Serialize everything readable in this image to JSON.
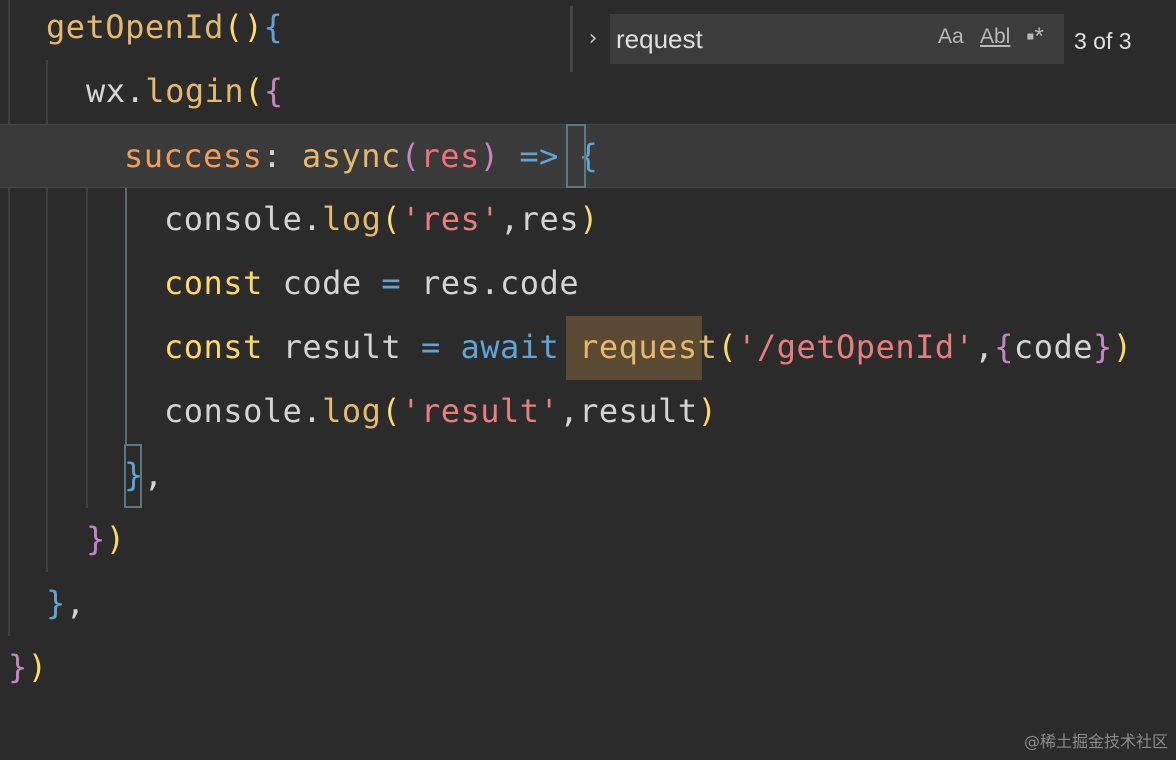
{
  "editor": {
    "lines": {
      "l1": [
        "getOpenId",
        "()",
        "{"
      ],
      "l2": [
        "wx",
        ".",
        "login",
        "(",
        "{"
      ],
      "l3": [
        "success",
        ": ",
        "async",
        "(",
        "res",
        ") ",
        "=>",
        " ",
        "{"
      ],
      "l4": [
        "console",
        ".",
        "log",
        "(",
        "'res'",
        ",",
        "res",
        ")"
      ],
      "l5": [
        "const",
        " code ",
        "=",
        " res",
        ".",
        "code"
      ],
      "l6": [
        "const",
        " result ",
        "=",
        " ",
        "await",
        " ",
        "request",
        "(",
        "'/getOpenId'",
        ",",
        "{",
        "code",
        "}",
        ")"
      ],
      "l7": [
        "console",
        ".",
        "log",
        "(",
        "'result'",
        ",",
        "result",
        ")"
      ],
      "l8": [
        "}",
        ","
      ],
      "l9": [
        "}",
        ")"
      ],
      "l10": [
        "}",
        ","
      ],
      "l11": [
        "}",
        ")"
      ]
    }
  },
  "find": {
    "query": "request",
    "toggle_icon": "chevron-right-icon",
    "toggle_glyph": "›",
    "match_case_label": "Aa",
    "whole_word_label": "Abl",
    "regex_label": "▪*",
    "count": "3 of 3"
  },
  "watermark": "@稀土掘金技术社区",
  "colors": {
    "background": "#2b2b2b",
    "active_line": "#3a3a3a",
    "match_highlight": "#5b4a33",
    "find_input": "#3c3c3c"
  }
}
